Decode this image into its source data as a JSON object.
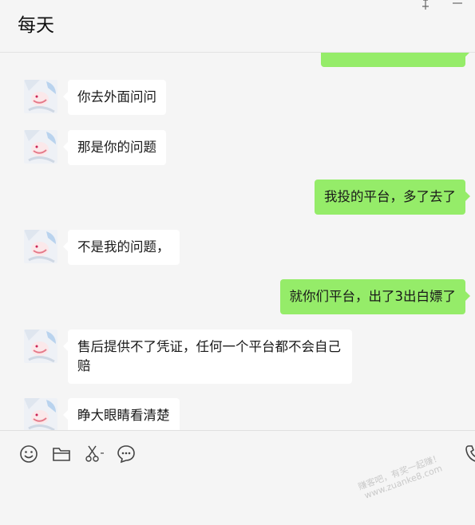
{
  "header": {
    "title": "每天"
  },
  "messages": [
    {
      "side": "right",
      "text": ""
    },
    {
      "side": "left",
      "text": "你去外面问问"
    },
    {
      "side": "left",
      "text": "那是你的问题"
    },
    {
      "side": "right",
      "text": "我投的平台，多了去了"
    },
    {
      "side": "left",
      "text": "不是我的问题，"
    },
    {
      "side": "right",
      "text": "就你们平台，出了3出白嫖了"
    },
    {
      "side": "left",
      "text": "售后提供不了凭证，任何一个平台都不会自己赔"
    },
    {
      "side": "left",
      "text": "睁大眼睛看清楚"
    }
  ],
  "toolbar": {
    "icons": [
      "emoji-icon",
      "folder-icon",
      "scissors-icon",
      "chat-history-icon",
      "phone-icon"
    ]
  },
  "watermark": {
    "line1": "赚客吧，有奖一起赚！",
    "line2": "www.zuanke8.com"
  },
  "colors": {
    "sent_bubble": "#95ec69",
    "received_bubble": "#ffffff",
    "background": "#f5f5f5"
  }
}
